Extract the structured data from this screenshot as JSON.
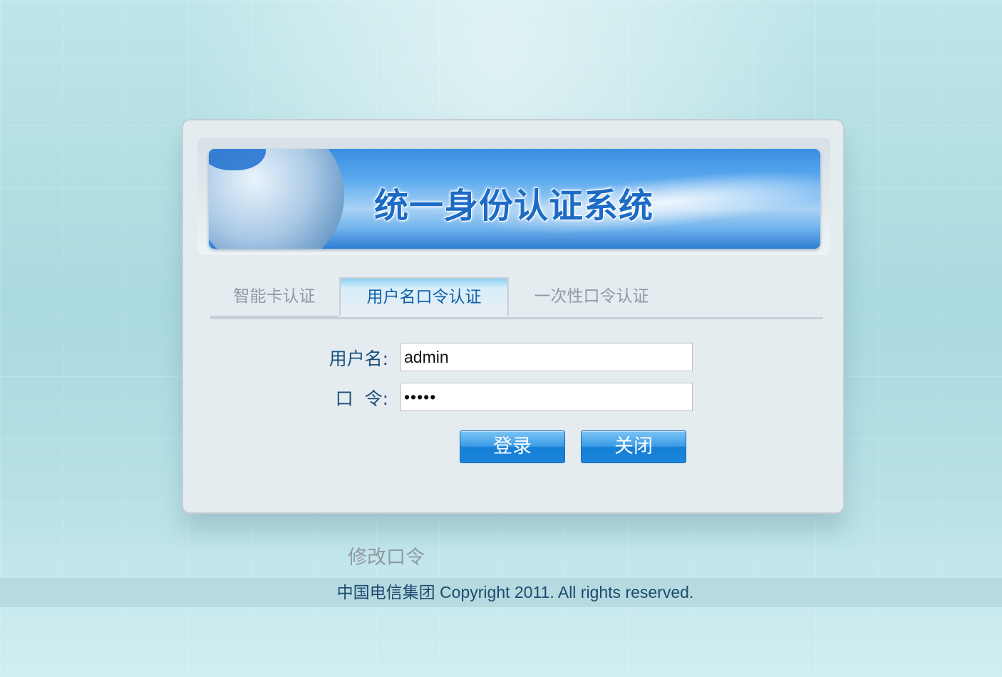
{
  "banner": {
    "title": "统一身份认证系统"
  },
  "tabs": [
    {
      "label": "智能卡认证",
      "active": false
    },
    {
      "label": "用户名口令认证",
      "active": true
    },
    {
      "label": "一次性口令认证",
      "active": false
    }
  ],
  "form": {
    "username_label": "用户名:",
    "username_value": "admin",
    "password_label": "口  令:",
    "password_value": "•••••"
  },
  "buttons": {
    "login": "登录",
    "close": "关闭"
  },
  "links": {
    "change_password": "修改口令"
  },
  "footer": {
    "text": "中国电信集团 Copyright 2011. All rights reserved."
  },
  "colors": {
    "accent": "#1c86dc",
    "tab_active_text": "#1060a8",
    "label": "#1a4f7a"
  }
}
